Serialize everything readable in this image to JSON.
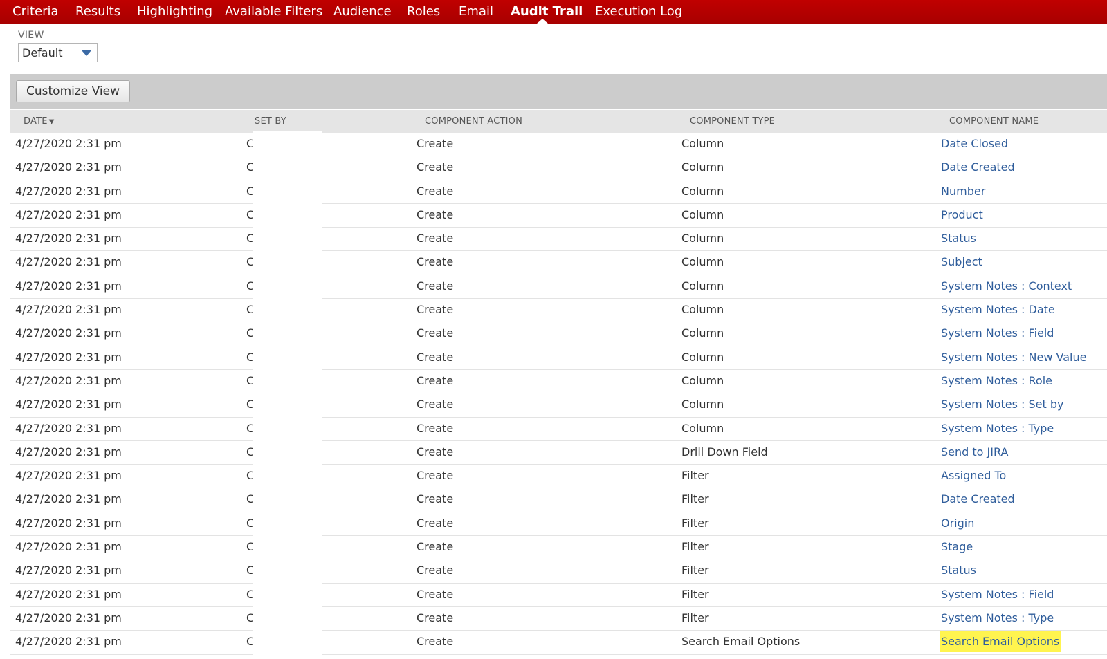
{
  "tabs": [
    {
      "label": "Criteria",
      "pre": "",
      "u": "C",
      "post": "riteria",
      "active": false
    },
    {
      "label": "Results",
      "pre": "",
      "u": "R",
      "post": "esults",
      "active": false
    },
    {
      "label": "Highlighting",
      "pre": "",
      "u": "H",
      "post": "ighlighting",
      "active": false
    },
    {
      "label": "Available Filters",
      "pre": "",
      "u": "A",
      "post": "vailable Filters",
      "active": false
    },
    {
      "label": "Audience",
      "pre": "A",
      "u": "u",
      "post": "dience",
      "active": false
    },
    {
      "label": "Roles",
      "pre": "R",
      "u": "o",
      "post": "les",
      "active": false
    },
    {
      "label": "Email",
      "pre": "",
      "u": "E",
      "post": "mail",
      "active": false
    },
    {
      "label": "Audit Trail",
      "pre": "Aud",
      "u": "i",
      "post": "t Trail",
      "active": true
    },
    {
      "label": "Execution Log",
      "pre": "E",
      "u": "x",
      "post": "ecution Log",
      "active": false
    }
  ],
  "view": {
    "label": "VIEW",
    "value": "Default"
  },
  "toolbar": {
    "customize_label": "Customize View"
  },
  "table": {
    "columns": [
      "DATE",
      "SET BY",
      "COMPONENT ACTION",
      "COMPONENT TYPE",
      "COMPONENT NAME"
    ],
    "sort_indicator": "▼",
    "rows": [
      {
        "date": "4/27/2020 2:31 pm",
        "set_by": "C",
        "action": "Create",
        "type": "Column",
        "name": "Date Closed"
      },
      {
        "date": "4/27/2020 2:31 pm",
        "set_by": "C",
        "action": "Create",
        "type": "Column",
        "name": "Date Created"
      },
      {
        "date": "4/27/2020 2:31 pm",
        "set_by": "C",
        "action": "Create",
        "type": "Column",
        "name": "Number"
      },
      {
        "date": "4/27/2020 2:31 pm",
        "set_by": "C",
        "action": "Create",
        "type": "Column",
        "name": "Product"
      },
      {
        "date": "4/27/2020 2:31 pm",
        "set_by": "C",
        "action": "Create",
        "type": "Column",
        "name": "Status"
      },
      {
        "date": "4/27/2020 2:31 pm",
        "set_by": "C",
        "action": "Create",
        "type": "Column",
        "name": "Subject"
      },
      {
        "date": "4/27/2020 2:31 pm",
        "set_by": "C",
        "action": "Create",
        "type": "Column",
        "name": "System Notes : Context"
      },
      {
        "date": "4/27/2020 2:31 pm",
        "set_by": "C",
        "action": "Create",
        "type": "Column",
        "name": "System Notes : Date"
      },
      {
        "date": "4/27/2020 2:31 pm",
        "set_by": "C",
        "action": "Create",
        "type": "Column",
        "name": "System Notes : Field"
      },
      {
        "date": "4/27/2020 2:31 pm",
        "set_by": "C",
        "action": "Create",
        "type": "Column",
        "name": "System Notes : New Value"
      },
      {
        "date": "4/27/2020 2:31 pm",
        "set_by": "C",
        "action": "Create",
        "type": "Column",
        "name": "System Notes : Role"
      },
      {
        "date": "4/27/2020 2:31 pm",
        "set_by": "C",
        "action": "Create",
        "type": "Column",
        "name": "System Notes : Set by"
      },
      {
        "date": "4/27/2020 2:31 pm",
        "set_by": "C",
        "action": "Create",
        "type": "Column",
        "name": "System Notes : Type"
      },
      {
        "date": "4/27/2020 2:31 pm",
        "set_by": "C",
        "action": "Create",
        "type": "Drill Down Field",
        "name": "Send to JIRA"
      },
      {
        "date": "4/27/2020 2:31 pm",
        "set_by": "C",
        "action": "Create",
        "type": "Filter",
        "name": "Assigned To"
      },
      {
        "date": "4/27/2020 2:31 pm",
        "set_by": "C",
        "action": "Create",
        "type": "Filter",
        "name": "Date Created"
      },
      {
        "date": "4/27/2020 2:31 pm",
        "set_by": "C",
        "action": "Create",
        "type": "Filter",
        "name": "Origin"
      },
      {
        "date": "4/27/2020 2:31 pm",
        "set_by": "C",
        "action": "Create",
        "type": "Filter",
        "name": "Stage"
      },
      {
        "date": "4/27/2020 2:31 pm",
        "set_by": "C",
        "action": "Create",
        "type": "Filter",
        "name": "Status"
      },
      {
        "date": "4/27/2020 2:31 pm",
        "set_by": "C",
        "action": "Create",
        "type": "Filter",
        "name": "System Notes : Field"
      },
      {
        "date": "4/27/2020 2:31 pm",
        "set_by": "C",
        "action": "Create",
        "type": "Filter",
        "name": "System Notes : Type"
      },
      {
        "date": "4/27/2020 2:31 pm",
        "set_by": "C",
        "action": "Create",
        "type": "Search Email Options",
        "name": "Search Email Options",
        "highlight": true
      }
    ]
  },
  "colors": {
    "tab_bar": "#b00000",
    "link": "#2f5d9b",
    "highlight": "#fff44f",
    "toolbar": "#cccccc"
  }
}
